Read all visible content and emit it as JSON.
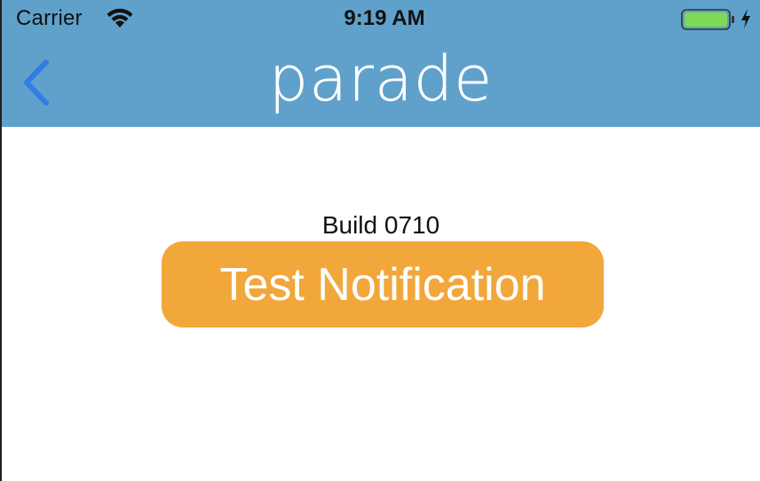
{
  "status_bar": {
    "carrier": "Carrier",
    "time": "9:19 AM",
    "wifi_icon": "wifi-icon",
    "battery_icon": "battery-icon",
    "charging_icon": "charging-bolt-icon",
    "battery_level": 1.0
  },
  "nav": {
    "back_icon": "chevron-left-icon",
    "logo_text": "parade"
  },
  "main": {
    "build_label": "Build 0710",
    "test_button_label": "Test Notification"
  },
  "colors": {
    "header": "#5fa1ca",
    "back_chevron": "#2f7ee6",
    "button": "#f2a73b",
    "button_text": "#ffffff",
    "battery_fill": "#7ed957"
  }
}
